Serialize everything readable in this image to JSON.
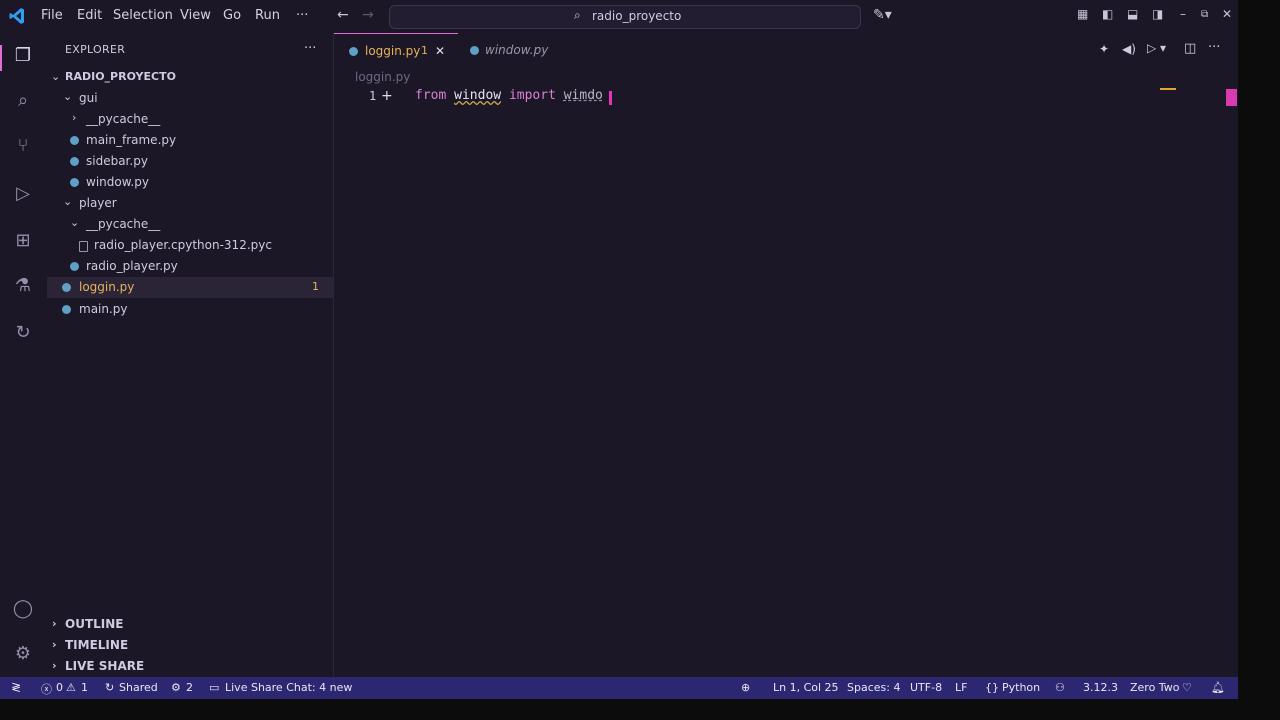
{
  "titlebar": {
    "menu": [
      "File",
      "Edit",
      "Selection",
      "View",
      "Go",
      "Run",
      "···"
    ],
    "search_text": "radio_proyecto"
  },
  "sidebar": {
    "title": "EXPLORER",
    "root": "RADIO_PROYECTO",
    "tree": [
      {
        "label": "gui",
        "kind": "folder-open"
      },
      {
        "label": "__pycache__",
        "kind": "folder-closed"
      },
      {
        "label": "main_frame.py",
        "kind": "py"
      },
      {
        "label": "sidebar.py",
        "kind": "py"
      },
      {
        "label": "window.py",
        "kind": "py"
      },
      {
        "label": "player",
        "kind": "folder-open"
      },
      {
        "label": "__pycache__",
        "kind": "folder-open"
      },
      {
        "label": "radio_player.cpython-312.pyc",
        "kind": "pyc"
      },
      {
        "label": "radio_player.py",
        "kind": "py"
      },
      {
        "label": "loggin.py",
        "kind": "py",
        "badge": "1"
      },
      {
        "label": "main.py",
        "kind": "py"
      }
    ],
    "sections": [
      "OUTLINE",
      "TIMELINE",
      "LIVE SHARE"
    ]
  },
  "editor": {
    "tabs": [
      {
        "label": "loggin.py",
        "badge": "1"
      },
      {
        "label": "window.py"
      }
    ],
    "breadcrumb": "loggin.py",
    "line_number": "1",
    "code": {
      "kw1": "from",
      "module": "window",
      "kw2": "import",
      "name": "wimdo"
    }
  },
  "statusbar": {
    "errors": "0",
    "warnings": "1",
    "shared": "Shared",
    "ports": "2",
    "live_share_chat": "Live Share Chat: 4 new",
    "position": "Ln 1, Col 25",
    "spaces": "Spaces: 4",
    "encoding": "UTF-8",
    "eol": "LF",
    "language": "Python",
    "python_version": "3.12.3",
    "theme": "Zero Two"
  },
  "colors": {
    "accent": "#e26ed4",
    "statusbar": "#2c2770",
    "bg": "#1b1726"
  }
}
